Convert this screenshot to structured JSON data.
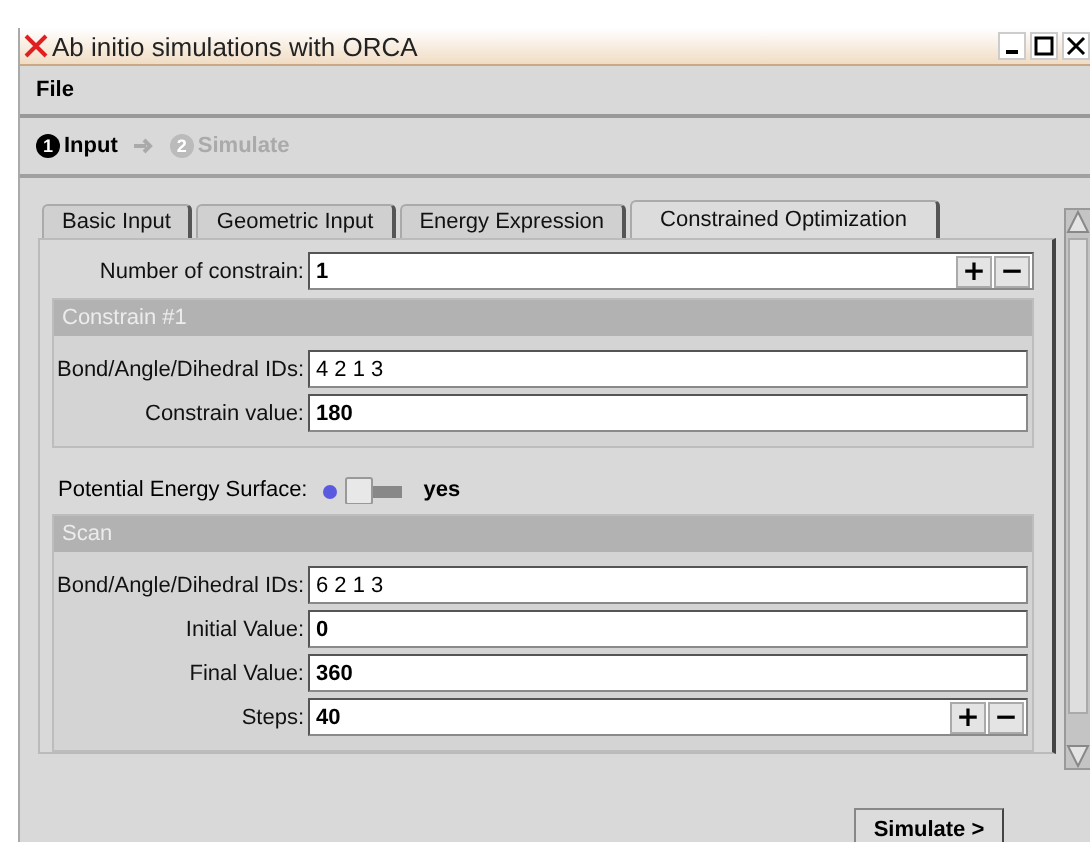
{
  "window": {
    "title": "Ab initio simulations with ORCA"
  },
  "menu": [
    {
      "label": "File"
    }
  ],
  "steps": [
    {
      "number": "1",
      "label": "Input",
      "selected": true
    },
    {
      "number": "2",
      "label": "Simulate",
      "selected": false
    }
  ],
  "tabs": [
    {
      "label": "Basic Input",
      "selected": false
    },
    {
      "label": "Geometric Input",
      "selected": false
    },
    {
      "label": "Energy Expression",
      "selected": false
    },
    {
      "label": "Constrained Optimization",
      "selected": true
    }
  ],
  "number_of_constrain": {
    "label": "Number of constrain:",
    "value": "1",
    "kind": "spinner",
    "spin_buttons": [
      "+",
      "−"
    ]
  },
  "constrain_group": {
    "title": "Constrain #1",
    "fields": [
      {
        "label": "Bond/Angle/Dihedral IDs:",
        "value": "4 2 1 3",
        "kind": "text"
      },
      {
        "label": "Constrain value:",
        "value": "180",
        "kind": "number"
      }
    ]
  },
  "pes": {
    "label": "Potential Energy Surface:",
    "on": true,
    "state_text": "yes"
  },
  "scan_group": {
    "title": "Scan",
    "fields": [
      {
        "label": "Bond/Angle/Dihedral IDs:",
        "value": "6 2 1 3",
        "kind": "text"
      },
      {
        "label": "Initial Value:",
        "value": "0",
        "kind": "number"
      },
      {
        "label": "Final Value:",
        "value": "360",
        "kind": "number"
      },
      {
        "label": "Steps:",
        "value": "40",
        "kind": "spinner",
        "spin_buttons": [
          "+",
          "−"
        ]
      }
    ]
  },
  "buttons": [
    {
      "label": "Simulate >"
    }
  ]
}
